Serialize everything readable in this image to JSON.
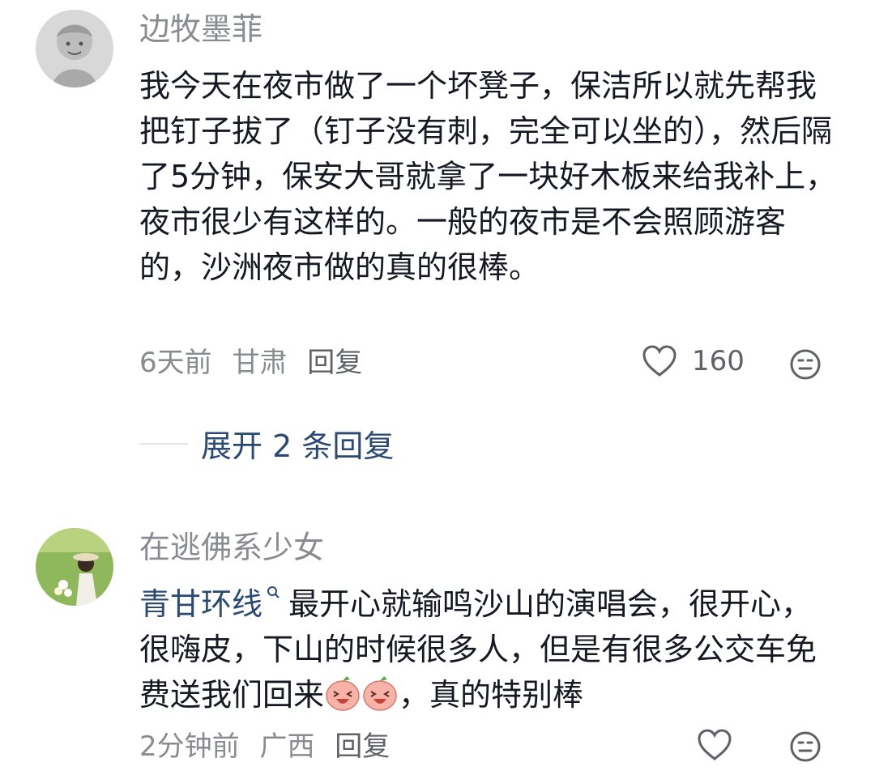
{
  "comments": [
    {
      "username": "边牧墨菲",
      "text": "我今天在夜市做了一个坏凳子，保洁所以就先帮我把钉子拔了（钉子没有刺，完全可以坐的），然后隔了5分钟，保安大哥就拿了一块好木板来给我补上，夜市很少有这样的。一般的夜市是不会照顾游客的，沙洲夜市做的真的很棒。",
      "time": "6天前",
      "location": "甘肃",
      "reply_label": "回复",
      "likes": "160",
      "icons": {
        "like": "heart-outline-icon",
        "emoji": "emoji-face-icon"
      }
    },
    {
      "username": "在逃佛系少女",
      "mention": "青甘环线",
      "mention_icon": "search-icon",
      "text_before_emoji": "最开心就输鸣沙山的演唱会，很开心，很嗨皮，下山的时候很多人，但是有很多公交车免费送我们回来",
      "text_after_emoji": "，真的特别棒",
      "inline_emojis": [
        "laughing-peach-emoji",
        "laughing-peach-emoji"
      ],
      "time": "2分钟前",
      "location": "广西",
      "reply_label": "回复",
      "icons": {
        "like": "heart-outline-icon",
        "emoji": "emoji-face-icon"
      }
    }
  ],
  "expand_replies": {
    "label": "展开 2 条回复"
  },
  "colors": {
    "text": "#161823",
    "secondary": "#8a8b91",
    "link": "#2b4a73",
    "divider": "#e3e3e5"
  }
}
